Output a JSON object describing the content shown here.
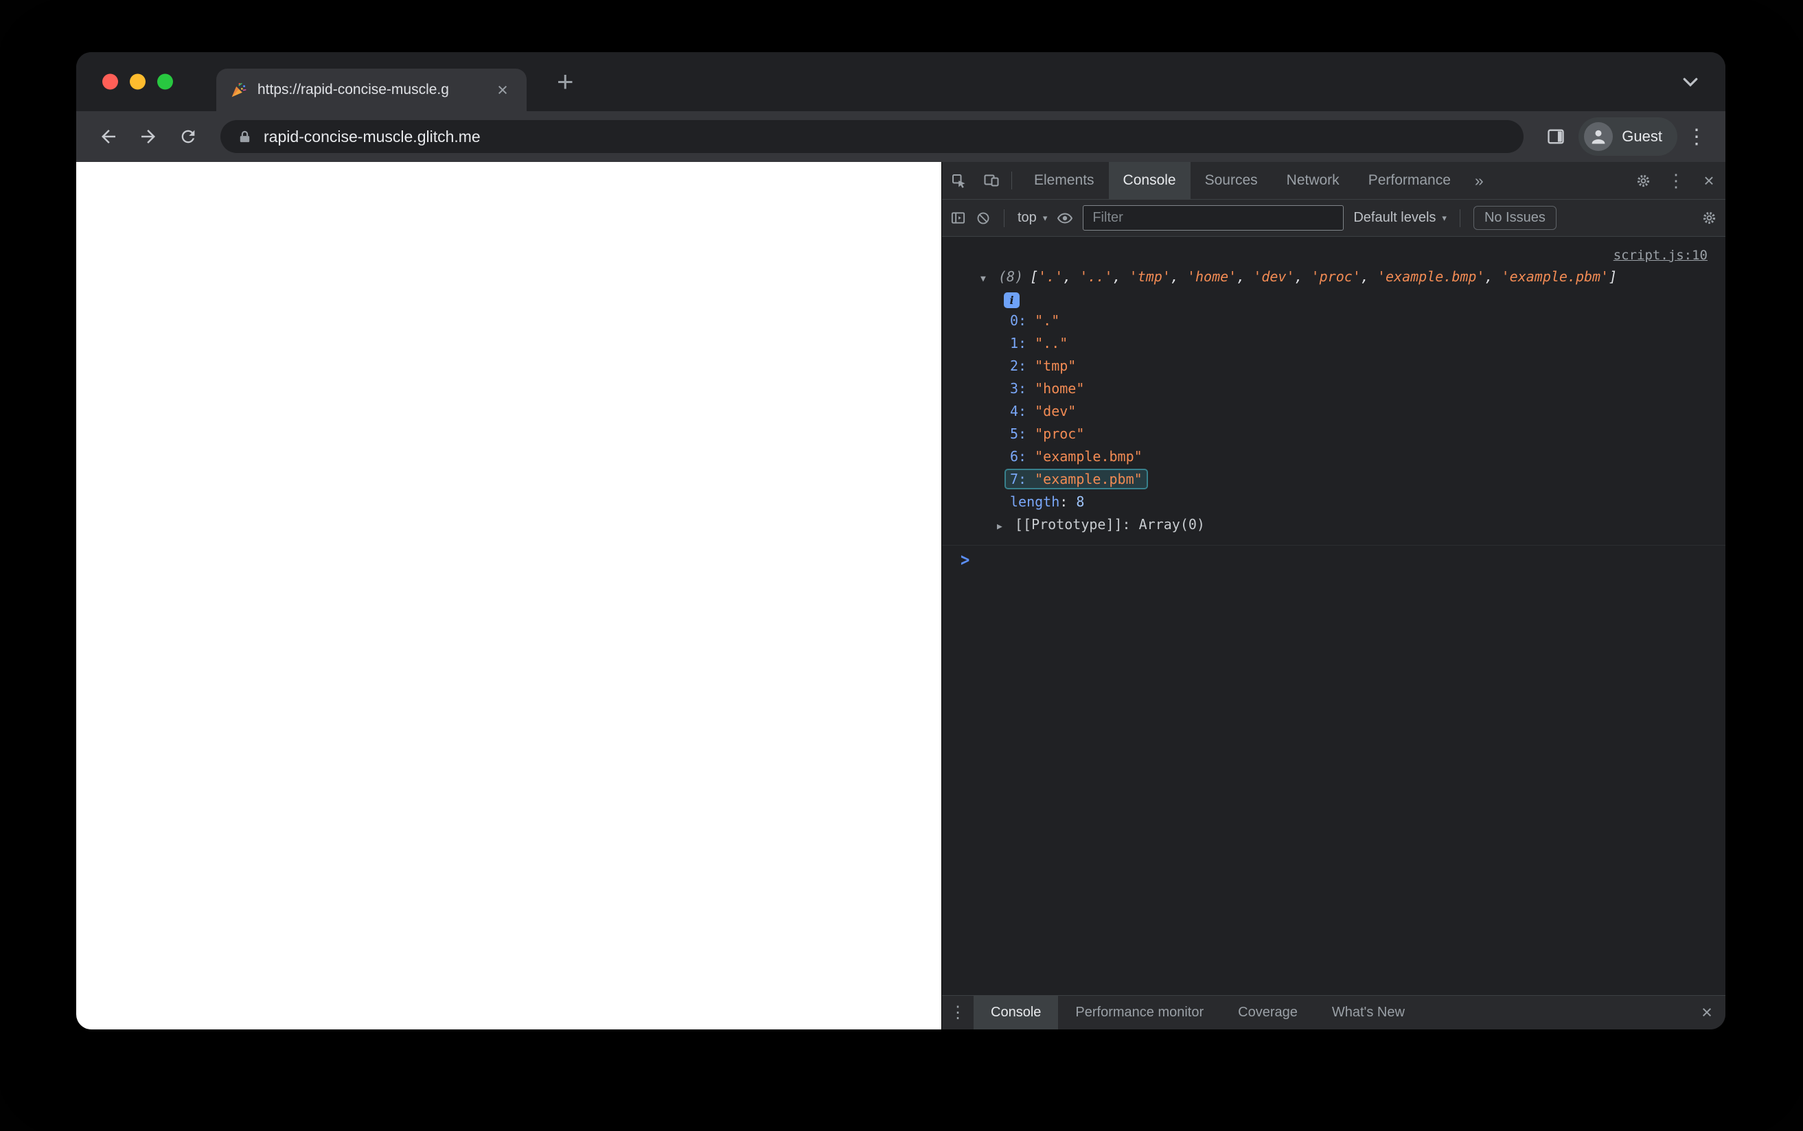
{
  "browser": {
    "tab_title": "https://rapid-concise-muscle.g",
    "url": "rapid-concise-muscle.glitch.me",
    "guest_label": "Guest"
  },
  "devtools": {
    "main_tabs": [
      {
        "label": "Elements",
        "active": false
      },
      {
        "label": "Console",
        "active": true
      },
      {
        "label": "Sources",
        "active": false
      },
      {
        "label": "Network",
        "active": false
      },
      {
        "label": "Performance",
        "active": false
      }
    ],
    "more_tabs_glyph": "»",
    "console_toolbar": {
      "context_label": "top",
      "filter_placeholder": "Filter",
      "levels_label": "Default levels",
      "issues_label": "No Issues"
    },
    "console": {
      "source_link": "script.js:10",
      "array_summary": "(8)",
      "array_values": [
        ".",
        "..",
        "tmp",
        "home",
        "dev",
        "proc",
        "example.bmp",
        "example.pbm"
      ],
      "highlight_index": 7,
      "length_label": "length",
      "length_value": "8",
      "prototype_label": "[[Prototype]]",
      "prototype_value": "Array(0)",
      "punct": {
        "open_bracket": "[",
        "close_bracket": "]",
        "comma": ", ",
        "colon": ": ",
        "single_quote": "'",
        "double_quote": "\""
      }
    },
    "drawer_tabs": [
      {
        "label": "Console",
        "active": true
      },
      {
        "label": "Performance monitor",
        "active": false
      },
      {
        "label": "Coverage",
        "active": false
      },
      {
        "label": "What's New",
        "active": false
      }
    ]
  },
  "glyphs": {
    "plus": "+",
    "close": "×",
    "kebab": "⋮",
    "caret_down": "▾",
    "disclosure_open": "▼",
    "disclosure_closed": "▶",
    "info_badge": "i",
    "prompt": ">"
  },
  "colors": {
    "traffic_red": "#ff5f57",
    "traffic_yellow": "#febc2e",
    "traffic_green": "#28c840",
    "string_color": "#f28b54",
    "index_color": "#7aa7f8",
    "number_color": "#9ec3f8",
    "highlight_color": "#4dd0e1",
    "accent_blue": "#5b8ef5"
  }
}
